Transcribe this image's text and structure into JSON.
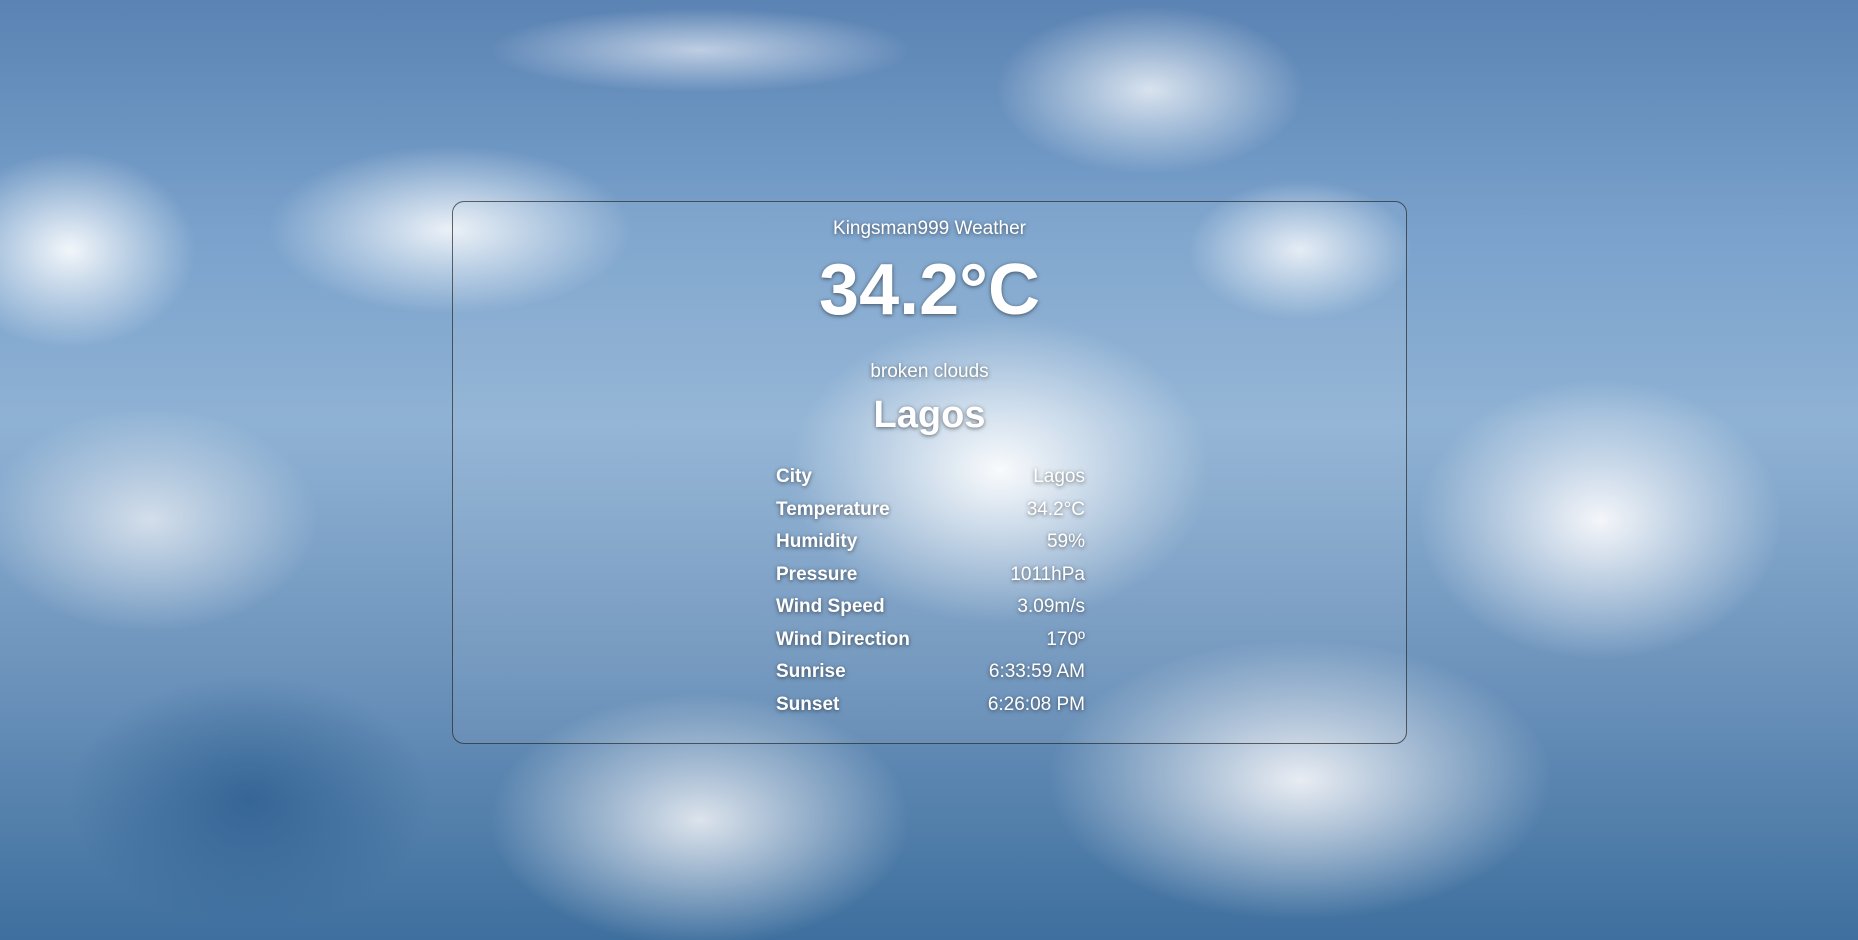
{
  "app": {
    "title": "Kingsman999 Weather"
  },
  "current": {
    "temperature": "34.2°C",
    "description": "broken clouds",
    "city": "Lagos"
  },
  "details": [
    {
      "label": "City",
      "value": "Lagos"
    },
    {
      "label": "Temperature",
      "value": "34.2°C"
    },
    {
      "label": "Humidity",
      "value": "59%"
    },
    {
      "label": "Pressure",
      "value": "1011hPa"
    },
    {
      "label": "Wind Speed",
      "value": "3.09m/s"
    },
    {
      "label": "Wind Direction",
      "value": "170º"
    },
    {
      "label": "Sunrise",
      "value": "6:33:59 AM"
    },
    {
      "label": "Sunset",
      "value": "6:26:08 PM"
    }
  ],
  "colors": {
    "text": "#ffffff",
    "card_border": "#282828",
    "sky": "#7aa2cc"
  }
}
